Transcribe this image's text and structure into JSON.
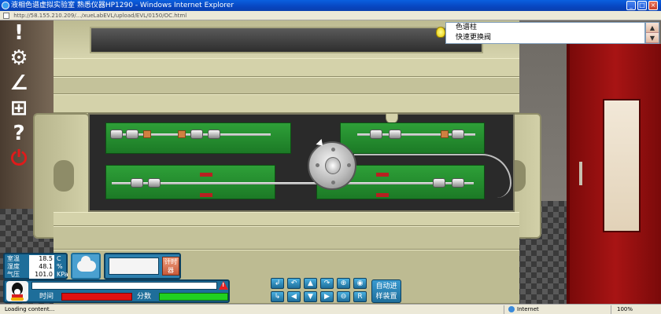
{
  "window": {
    "title": "液相色谱虚拟实验室 熟悉仪器HP1290 - Windows Internet Explorer",
    "address": "http://58.155.210.209/.../xueLabEVL/upload/EVL/0150/OC.html"
  },
  "info_panel": {
    "line1": "色谱柱",
    "line2": "快速更换阀"
  },
  "environment": {
    "temp_label": "室温",
    "temp_value": "18.5",
    "temp_unit": "C",
    "humidity_label": "湿度",
    "humidity_value": "48.1",
    "humidity_unit": "%",
    "pressure_label": "气压",
    "pressure_value": "101.0",
    "pressure_unit": "KPa"
  },
  "timer": {
    "button_label": "计时 器"
  },
  "status": {
    "time_label": "时间",
    "score_label": "分数",
    "time_level": 1.0,
    "score_level": 1.0
  },
  "nav": {
    "buttons_top": [
      "↲",
      "↶",
      "▲",
      "↷",
      "⊕",
      "◉"
    ],
    "buttons_bottom": [
      "↳",
      "◀",
      "▼",
      "▶",
      "⊖",
      "R"
    ]
  },
  "auto_button": {
    "label": "自动进 样装置"
  },
  "left_tools": [
    "!",
    "⚙",
    "∠",
    "⊞",
    "?",
    "⏻"
  ],
  "statusbar": {
    "left": "Loading content...",
    "zone": "Internet",
    "zoom": "100%"
  },
  "colors": {
    "accent": "#1E6E9A",
    "time_bar": "#E01010",
    "score_bar": "#20D020",
    "door": "#A81414"
  }
}
